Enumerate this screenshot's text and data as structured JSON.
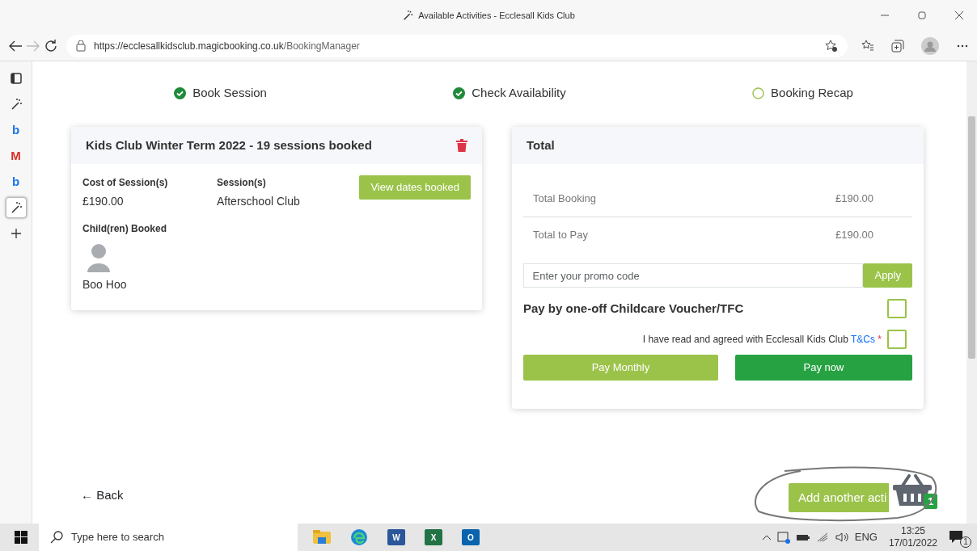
{
  "window": {
    "title": "Available Activities - Ecclesall Kids Club"
  },
  "address_bar": {
    "url_host": "https://ecclesallkidsclub.magicbooking.co.uk",
    "url_path": "/BookingManager"
  },
  "sidebar": {
    "items": [
      {
        "kind": "tabs",
        "selected": false
      },
      {
        "kind": "wand",
        "selected": false
      },
      {
        "kind": "letter",
        "glyph": "b",
        "color": "#1a73e8",
        "selected": false
      },
      {
        "kind": "letter",
        "glyph": "M",
        "color": "#d93025",
        "selected": false
      },
      {
        "kind": "letter",
        "glyph": "b",
        "color": "#1a73e8",
        "selected": false
      },
      {
        "kind": "wand",
        "selected": true
      },
      {
        "kind": "plus",
        "selected": false
      }
    ]
  },
  "steps": [
    {
      "label": "Book Session",
      "done": true
    },
    {
      "label": "Check Availability",
      "done": true
    },
    {
      "label": "Booking Recap",
      "done": false
    }
  ],
  "booking_card": {
    "title": "Kids Club Winter Term 2022 - 19 sessions booked",
    "cost_label": "Cost of Session(s)",
    "cost": "£190.00",
    "sessions_label": "Session(s)",
    "sessions": "Afterschool Club",
    "view_button": "View dates booked",
    "children_label": "Child(ren) Booked",
    "children": [
      "Boo Hoo"
    ]
  },
  "total_card": {
    "title": "Total",
    "rows": [
      {
        "label": "Total Booking",
        "value": "£190.00"
      },
      {
        "label": "Total to Pay",
        "value": "£190.00"
      }
    ],
    "promo": {
      "placeholder": "Enter your promo code",
      "button": "Apply"
    },
    "voucher": {
      "label": "Pay by one-off Childcare Voucher/TFC",
      "checked": false
    },
    "terms": {
      "text": "I have read and agreed with Ecclesall Kids Club",
      "link": "T&Cs",
      "required_mark": "*",
      "checked": false
    },
    "buttons": [
      {
        "label": "Pay Monthly",
        "kind": "light"
      },
      {
        "label": "Pay now",
        "kind": "dark"
      }
    ]
  },
  "back_link": "← Back",
  "add_button": "Add another acti",
  "basket": {
    "count": "1"
  },
  "taskbar": {
    "search_placeholder": "Type here to search",
    "apps": [
      {
        "kind": "folder"
      },
      {
        "kind": "edge"
      },
      {
        "kind": "office",
        "letter": "W",
        "color": "#2b579a"
      },
      {
        "kind": "office",
        "letter": "X",
        "color": "#217346"
      },
      {
        "kind": "office",
        "letter": "O",
        "color": "#0a64ad"
      }
    ],
    "language": "ENG",
    "time": "13:25",
    "date": "17/01/2022",
    "notifications": "1"
  }
}
